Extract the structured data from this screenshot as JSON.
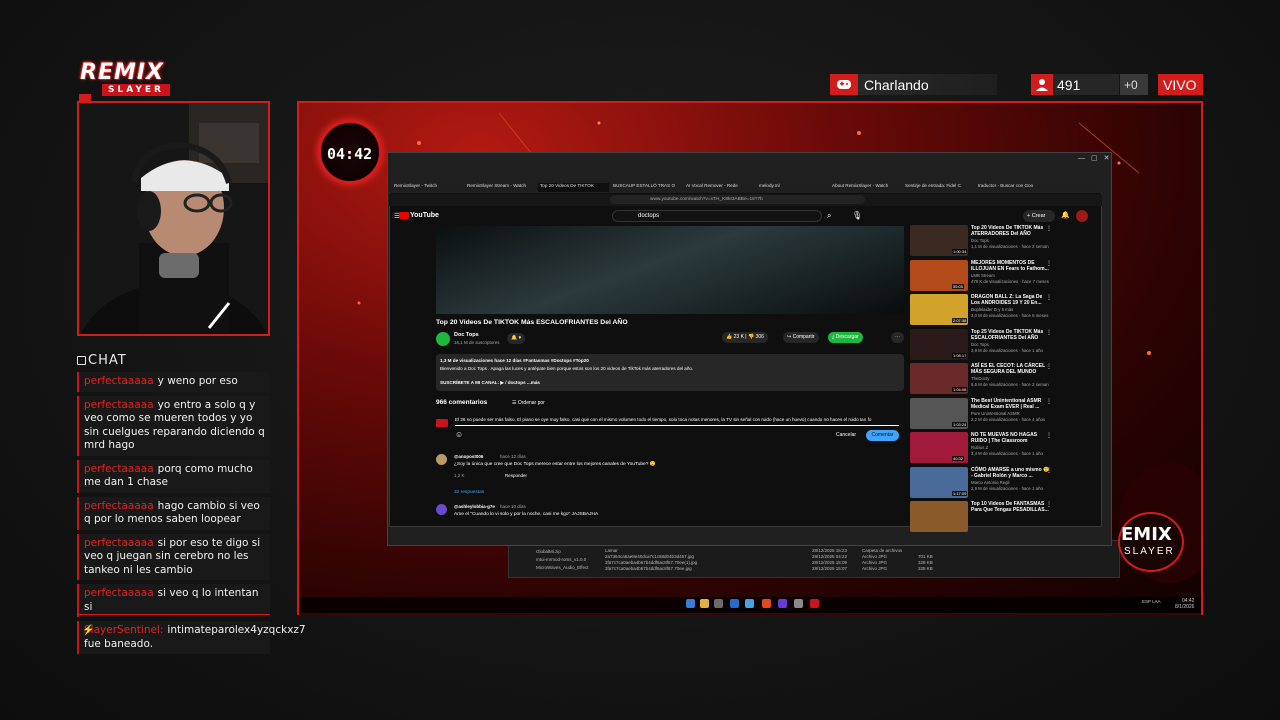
{
  "brand": {
    "logo_top": "REMIX",
    "logo_bottom": "SLAYER"
  },
  "status": {
    "activity": "Charlando",
    "viewers": "491",
    "plus": "+0",
    "live": "VIVO"
  },
  "timer": "04:42",
  "chat": {
    "label": "CHAT",
    "messages": [
      {
        "user": "perfectaaaaa",
        "text": "y weno por eso"
      },
      {
        "user": "perfectaaaaa",
        "text": "yo entro a solo q y veo como se mueren todos y yo sin cuelgues reparando diciendo q mrd hago"
      },
      {
        "user": "perfectaaaaa",
        "text": "porq como mucho me dan 1 chase"
      },
      {
        "user": "perfectaaaaa",
        "text": "hago cambio si veo q por lo menos saben loopear"
      },
      {
        "user": "perfectaaaaa",
        "text": "si por eso te digo si veo q juegan sin cerebro no les tankeo ni les cambio"
      },
      {
        "user": "perfectaaaaa",
        "text": "si veo q lo intentan si"
      },
      {
        "user": "SlayerSentinel:",
        "text": "intimateparolex4yzqckxz7 fue baneado."
      }
    ]
  },
  "browser": {
    "tabs": [
      "RemixSlayer - Twitch",
      "RemixSlayer Stream - Watch",
      "Top 20 Videos De TIKTOK",
      "BUSCAUP ESTALLÓ TRAS O",
      "AI Vocal Remover - Rede",
      "melody.ml",
      "About RemixSlayer - Watch",
      "Sentirje de entrada: Fidel C",
      "traductor - Buscar con Goo"
    ],
    "url": "www.youtube.com/watch?v=xTH_K8kI3ABBe=18?7b"
  },
  "youtube": {
    "logo": "YouTube",
    "search": "doctops",
    "create": "+ Crear",
    "video_title": "Top 20 Videos De TIKTOK Más ESCALOFRIANTES Del AÑO",
    "channel": "Doc Tops",
    "subscribers": "16,1 M de suscriptores",
    "likes": "23 K",
    "dislikes": "306",
    "share": "Compartir",
    "download": "Descargar",
    "desc_line1": "1,3 M de visualizaciones  hace 12 días  #Fantasmas #Doctops #Top20",
    "desc_line2": "Bienvenido a Doc Tops . Apaga las luces y antépate bien porque estos son los 20 videos de TikTok más aterradores del año.",
    "desc_line3": "SUSCRÍBETE A MI CANAL: ▶ / doctops ...más",
    "comments_count": "966 comentarios",
    "order_by": "Ordenar por",
    "comment_draft": "El 26 no puede ser más falso. El piano se oye muy falso, casi que con el mismo volumen todo el tiempo, solo toca notas menores, la TV sin señal con ruido (hace un huevo) cuando no haces el ruido tan fo",
    "cancel": "Cancelar",
    "comment_btn": "Comentar",
    "comments": [
      {
        "user": "@anopost006",
        "time": "hace 12 días",
        "text": "¿Soy la única que cree que Doc Tops merece estar entre los mejores canales de YouTube? 🙂",
        "likes": "1,2 K",
        "reply": "Responder"
      },
      {
        "user": "@ashleylobbia-g7e",
        "time": "hace 10 días",
        "text": "Ame el \"Cuando lo vi solo y por la noche, casi me kgo\" JAJSBAJHA"
      }
    ],
    "replies": "32 respuestas",
    "recommendations": [
      {
        "title": "Top 20 Videos De TIKTOK Más ATERRADORES Del AÑO",
        "channel": "Doc Tops",
        "meta": "1,1 M de visualizaciones · hace 2 seman",
        "duration": "1:00:34",
        "color": "#3a2a22"
      },
      {
        "title": "MEJORES MOMENTOS DE ILLOJUAN EN Fears to Fathom...",
        "channel": "LMB Stream",
        "meta": "479 K de visualizaciones · hace 7 meses",
        "duration": "55:05",
        "color": "#b34a1a"
      },
      {
        "title": "DRAGON BALL Z: La Saga De Los ANDROIDES 19 Y 20 En...",
        "channel": "Doplelaider D y 5 más",
        "meta": "3,0 M de visualizaciones · hace 6 meses",
        "duration": "2:07:38",
        "color": "#d2a32a"
      },
      {
        "title": "Top 25 Videos De TIKTOK Más ESCALOFRIANTES Del AÑO",
        "channel": "Doc Tops",
        "meta": "3,9 M de visualizaciones · hace 1 año",
        "duration": "1:08:17",
        "color": "#2a1a1a"
      },
      {
        "title": "ASÍ ES EL CECOT: LA CÁRCEL MÁS SEGURA DEL MUNDO",
        "channel": "TheDocty",
        "meta": "8,6 M de visualizaciones · hace 2 seman",
        "duration": "1:04:08",
        "color": "#6a2a2a"
      },
      {
        "title": "The Best Unintentional ASMR Medical Exam EVER | Real ...",
        "channel": "Pure Unintentional ASMR",
        "meta": "2,2 M de visualizaciones · hace 4 años",
        "duration": "1:03:24",
        "color": "#555555"
      },
      {
        "title": "NO TE MUEVAS NO HAGAS RUIDO | The Classroom",
        "channel": "Rubius Z",
        "meta": "3,4 M de visualizaciones · hace 1 año",
        "duration": "40:32",
        "color": "#a21a3a"
      },
      {
        "title": "CÓMO AMARSE a uno mismo 🙂 - Gabriel Rolón y Marco ...",
        "channel": "Marco Antonio Regil",
        "meta": "2,9 M de visualizaciones · hace 1 año",
        "duration": "1:17:09",
        "color": "#4a6a9a"
      },
      {
        "title": "Top 10 Videos De FANTASMAS Para Que Tengas PESADILLAS...",
        "channel": "",
        "meta": "",
        "duration": "",
        "color": "#8a5a2a"
      }
    ]
  },
  "explorer": {
    "rows": [
      {
        "name": "Lamar",
        "date": "28/12/2025 15:23",
        "type": "Carpeta de archivos",
        "size": ""
      },
      {
        "name": "2a7364ca6ae8e40dca7c1c58d04b3d457.jpg",
        "date": "28/12/2025 04:22",
        "type": "Archivo JPG",
        "size": "701 KB"
      },
      {
        "name": "3fa7c7ca0aeba4b67b4ddf6ac8f67.70ee(1).jpg",
        "date": "28/12/2025 15:09",
        "type": "Archivo JPG",
        "size": "328 KB"
      },
      {
        "name": "3fa7c7ca0aeba4b67b4ddf6ac8f67.70ee.jpg",
        "date": "28/12/2025 15:07",
        "type": "Archivo JPG",
        "size": "328 KB"
      }
    ],
    "left_items": [
      "GlobalMi.zip",
      "mtui-mrmod-roms_v1.0.0",
      "MicroWaves_Audio_Effect"
    ]
  },
  "taskbar": {
    "time": "04:42",
    "date": "8/1/2026",
    "lang": "ESP LAA"
  },
  "remix_right": {
    "t1": "EMIX",
    "t2": "SLAYER"
  }
}
